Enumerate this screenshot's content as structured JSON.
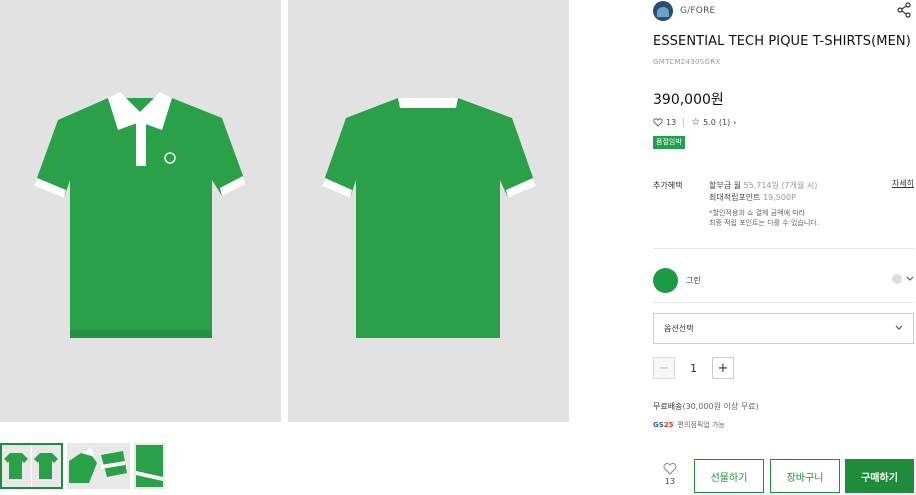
{
  "gallery": {
    "main_images": [
      "polo-front",
      "polo-back"
    ],
    "thumbnails": [
      "thumb-front-back",
      "thumb-detail",
      "thumb-sleeve"
    ]
  },
  "product": {
    "brand": "G/FORE",
    "title": "ESSENTIAL TECH PIQUE T-SHIRTS(MEN)",
    "code": "GMTCM2430SGRX",
    "price": "390,000원",
    "likes": "13",
    "rating": "5.0",
    "review_count": "(1)",
    "badge": "품절임박"
  },
  "benefit": {
    "label": "추가혜택",
    "installment_label": "할부금 월",
    "installment_amount": "55,714원",
    "installment_note": "(7개월 시)",
    "points_label": "최대적립포인트",
    "points_value": "19,500P",
    "note_line1": "*할인적용과 쇼 결제 금액에 따라",
    "note_line2": "최종 적립 포인트는 다를 수 있습니다.",
    "detail_link": "자세히"
  },
  "color": {
    "name": "그린",
    "swatch": "#1e9a45"
  },
  "option": {
    "placeholder": "옵션선택"
  },
  "quantity": {
    "value": "1",
    "minus": "−",
    "plus": "+"
  },
  "shipping": {
    "label": "무료배송",
    "note": "(30,000원 이상 무료)",
    "gs_logo_text": "GS",
    "gs_logo_num": "25",
    "pickup": "편의점픽업 가능"
  },
  "actions": {
    "like_count": "13",
    "gift": "선물하기",
    "cart": "장바구니",
    "buy": "구매하기"
  },
  "colors": {
    "accent": "#1e8c3a",
    "shirt_green": "#2aa148"
  }
}
